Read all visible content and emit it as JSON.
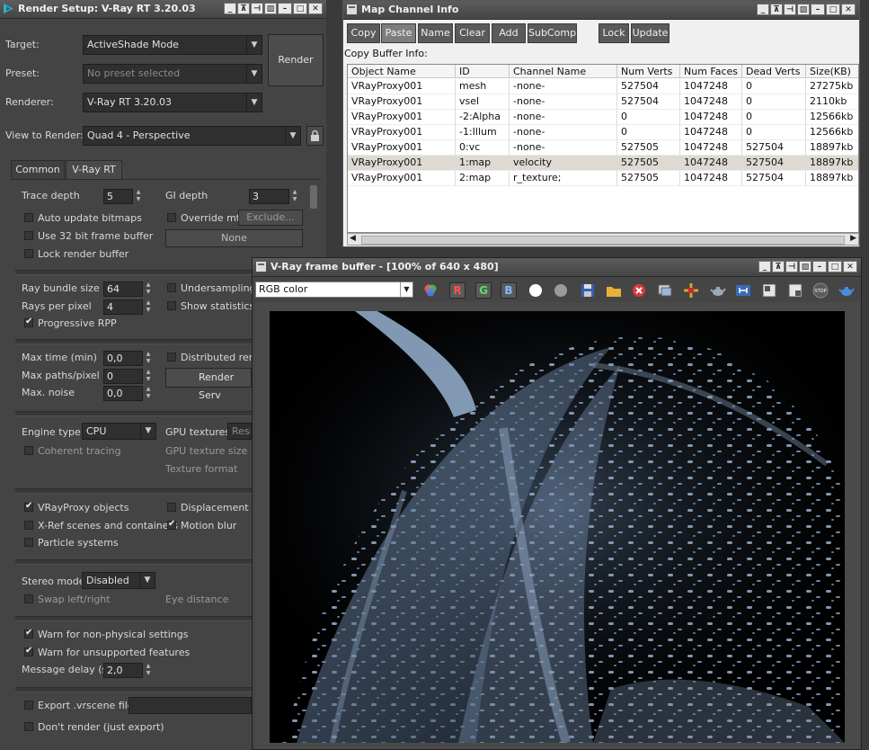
{
  "render_setup": {
    "title": "Render Setup: V-Ray RT 3.20.03",
    "target_label": "Target:",
    "target_value": "ActiveShade Mode",
    "preset_label": "Preset:",
    "preset_placeholder": "No preset selected",
    "renderer_label": "Renderer:",
    "renderer_value": "V-Ray RT 3.20.03",
    "view_label": "View to Render:",
    "view_value": "Quad 4 - Perspective",
    "render_button": "Render",
    "tabs": [
      "Common",
      "V-Ray RT"
    ],
    "trace_depth_label": "Trace depth",
    "trace_depth": "5",
    "gi_depth_label": "GI depth",
    "gi_depth": "3",
    "auto_update_bitmaps": "Auto update bitmaps",
    "override_mtl": "Override mtl",
    "exclude_button": "Exclude...",
    "use_32bit": "Use 32 bit frame buffer",
    "none_button": "None",
    "lock_render_buffer": "Lock render buffer",
    "ray_bundle_label": "Ray bundle size",
    "ray_bundle": "64",
    "undersampling": "Undersampling",
    "rays_per_pixel_label": "Rays per pixel",
    "rays_per_pixel": "4",
    "show_statistics": "Show statistics",
    "progressive_rpp": "Progressive RPP",
    "max_time_label": "Max time (min)",
    "max_time": "0,0",
    "distributed_rend": "Distributed rend",
    "max_paths_label": "Max paths/pixel",
    "max_paths": "0",
    "render_serv_button": "Render Serv",
    "max_noise_label": "Max. noise",
    "max_noise": "0,0",
    "engine_type_label": "Engine type",
    "engine_type": "CPU",
    "gpu_textures_label": "GPU textures",
    "gpu_textures_value": "Resiz",
    "coherent_tracing": "Coherent tracing",
    "gpu_texture_size_label": "GPU texture size",
    "texture_format_label": "Texture format",
    "vrayproxy_objects": "VRayProxy objects",
    "displacement": "Displacement",
    "xref_scenes": "X-Ref scenes and containers",
    "motion_blur": "Motion blur",
    "particle_systems": "Particle systems",
    "stereo_mode_label": "Stereo mode",
    "stereo_mode": "Disabled",
    "swap_left_right": "Swap left/right",
    "eye_distance_label": "Eye distance",
    "warn_non_physical": "Warn for non-physical settings",
    "warn_unsupported": "Warn for unsupported features",
    "message_delay_label": "Message delay (s)",
    "message_delay": "2,0",
    "export_vrscene": "Export .vrscene file",
    "dont_render": "Don't render (just export)"
  },
  "map_channel_info": {
    "title": "Map Channel Info",
    "buttons": [
      "Copy",
      "Paste",
      "Name",
      "Clear",
      "Add",
      "SubComp",
      "Lock",
      "Update"
    ],
    "copy_buffer_label": "Copy Buffer Info:",
    "columns": [
      "Object Name",
      "ID",
      "Channel Name",
      "Num Verts",
      "Num Faces",
      "Dead Verts",
      "Size(KB)"
    ],
    "rows": [
      [
        "VRayProxy001",
        "mesh",
        "-none-",
        "527504",
        "1047248",
        "0",
        "27275kb"
      ],
      [
        "VRayProxy001",
        "vsel",
        "-none-",
        "527504",
        "1047248",
        "0",
        "2110kb"
      ],
      [
        "VRayProxy001",
        "-2:Alpha",
        "-none-",
        "0",
        "1047248",
        "0",
        "12566kb"
      ],
      [
        "VRayProxy001",
        "-1:Illum",
        "-none-",
        "0",
        "1047248",
        "0",
        "12566kb"
      ],
      [
        "VRayProxy001",
        "0:vc",
        "-none-",
        "527505",
        "1047248",
        "527504",
        "18897kb"
      ],
      [
        "VRayProxy001",
        "1:map",
        "velocity",
        "527505",
        "1047248",
        "527504",
        "18897kb"
      ],
      [
        "VRayProxy001",
        "2:map",
        "r_texture;",
        "527505",
        "1047248",
        "527504",
        "18897kb"
      ]
    ],
    "selected_row": 5
  },
  "frame_buffer": {
    "title": "V-Ray frame buffer - [100% of 640 x 480]",
    "channel_value": "RGB color",
    "channel_buttons": [
      "R",
      "G",
      "B"
    ]
  }
}
